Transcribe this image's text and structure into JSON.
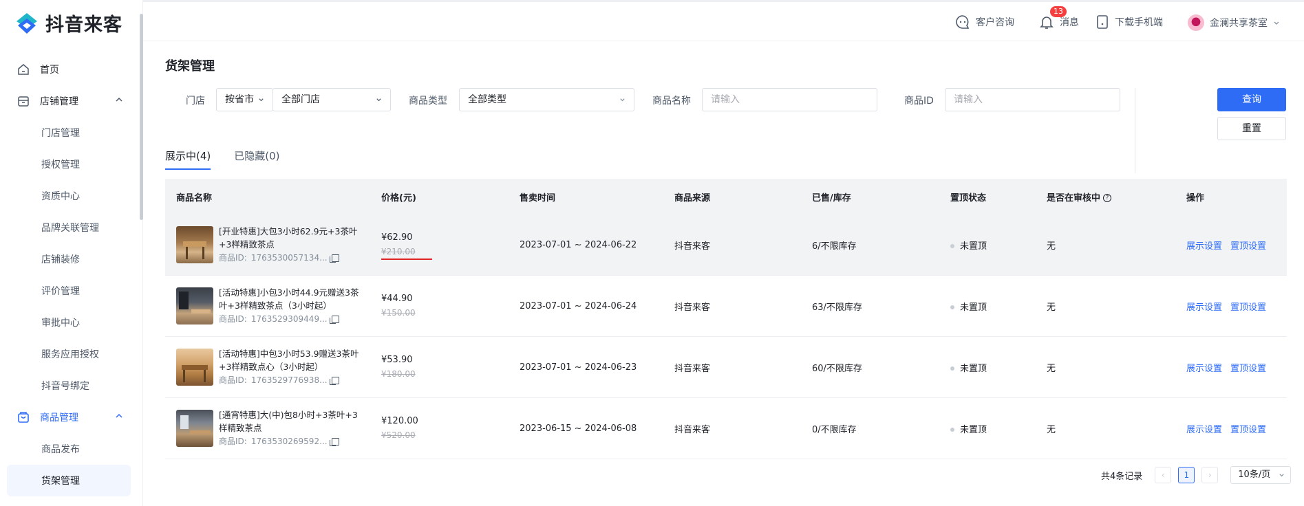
{
  "app": {
    "brand": "抖音来客"
  },
  "header": {
    "consult": "客户咨询",
    "messages": "消息",
    "message_badge": "13",
    "download": "下载手机端",
    "shop_name": "金澜共享茶室"
  },
  "sidebar": {
    "home": "首页",
    "store_group": "店铺管理",
    "store_items": [
      "门店管理",
      "授权管理",
      "资质中心",
      "品牌关联管理",
      "店铺装修",
      "评价管理",
      "审批中心",
      "服务应用授权",
      "抖音号绑定"
    ],
    "goods_group": "商品管理",
    "goods_items": [
      "商品发布",
      "货架管理"
    ]
  },
  "page": {
    "title": "货架管理"
  },
  "filters": {
    "store_label": "门店",
    "province_select": "按省市",
    "store_select": "全部门店",
    "type_label": "商品类型",
    "type_select": "全部类型",
    "name_label": "商品名称",
    "name_placeholder": "请输入",
    "id_label": "商品ID",
    "id_placeholder": "请输入",
    "query_btn": "查询",
    "reset_btn": "重置"
  },
  "tabs": [
    {
      "label": "展示中(4)"
    },
    {
      "label": "已隐藏(0)"
    }
  ],
  "table": {
    "headers": [
      "商品名称",
      "价格(元)",
      "售卖时间",
      "商品来源",
      "已售/库存",
      "置顶状态",
      "是否在审核中",
      "操作"
    ],
    "id_prefix": "商品ID:",
    "rows": [
      {
        "name": "[开业特惠]大包3小时62.9元+3茶叶+3样精致茶点",
        "id": "1763530057134...",
        "price": "¥62.90",
        "old_price": "¥210.00",
        "time": "2023-07-01 ~ 2024-06-22",
        "source": "抖音来客",
        "stock": "6/不限库存",
        "top": "未置顶",
        "review": "无",
        "action1": "展示设置",
        "action2": "置顶设置"
      },
      {
        "name": "[活动特惠]小包3小时44.9元赠送3茶叶+3样精致茶点（3小时起）",
        "id": "1763529309449...",
        "price": "¥44.90",
        "old_price": "¥150.00",
        "time": "2023-07-01 ~ 2024-06-24",
        "source": "抖音来客",
        "stock": "63/不限库存",
        "top": "未置顶",
        "review": "无",
        "action1": "展示设置",
        "action2": "置顶设置"
      },
      {
        "name": "[活动特惠]中包3小时53.9赠送3茶叶+3样精致点心（3小时起）",
        "id": "1763529776938...",
        "price": "¥53.90",
        "old_price": "¥180.00",
        "time": "2023-07-01 ~ 2024-06-23",
        "source": "抖音来客",
        "stock": "60/不限库存",
        "top": "未置顶",
        "review": "无",
        "action1": "展示设置",
        "action2": "置顶设置"
      },
      {
        "name": "[通宵特惠]大(中)包8小时+3茶叶+3样精致茶点",
        "id": "1763530269592...",
        "price": "¥120.00",
        "old_price": "¥520.00",
        "time": "2023-06-15 ~ 2024-06-08",
        "source": "抖音来客",
        "stock": "0/不限库存",
        "top": "未置顶",
        "review": "无",
        "action1": "展示设置",
        "action2": "置顶设置"
      }
    ]
  },
  "pagination": {
    "total": "共4条记录",
    "current": "1",
    "page_size": "10条/页"
  },
  "colors": {
    "accent": "#2f6cf6",
    "annotation": "#e02424"
  }
}
